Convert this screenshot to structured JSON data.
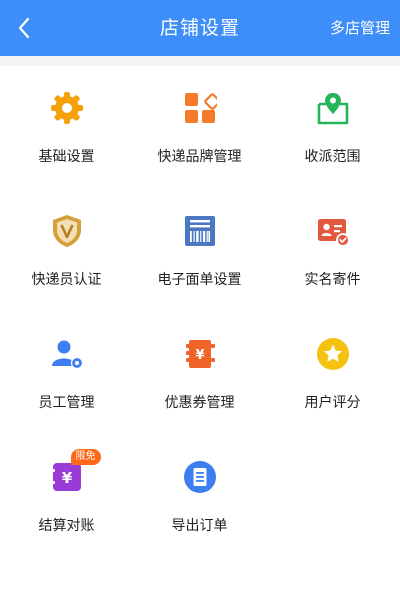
{
  "header": {
    "title": "店铺设置",
    "right_link": "多店管理",
    "back_icon": "chevron-left-icon",
    "bg_color": "#3d8ef8"
  },
  "menu": [
    {
      "id": "basic-settings",
      "label": "基础设置",
      "icon": "gear-icon",
      "color": "#f7a10a"
    },
    {
      "id": "courier-brand-management",
      "label": "快递品牌管理",
      "icon": "brand-blocks-icon",
      "color": "#f57a2a"
    },
    {
      "id": "delivery-range",
      "label": "收派范围",
      "icon": "map-pin-icon",
      "color": "#26b35a"
    },
    {
      "id": "courier-verification",
      "label": "快递员认证",
      "icon": "shield-v-icon",
      "color": "#d4a03a"
    },
    {
      "id": "e-waybill-settings",
      "label": "电子面单设置",
      "icon": "barcode-receipt-icon",
      "color": "#4a78c2"
    },
    {
      "id": "real-name-shipping",
      "label": "实名寄件",
      "icon": "id-card-icon",
      "color": "#e2583e"
    },
    {
      "id": "staff-management",
      "label": "员工管理",
      "icon": "staff-gear-icon",
      "color": "#3d7ef0"
    },
    {
      "id": "coupon-management",
      "label": "优惠券管理",
      "icon": "coupon-icon",
      "color": "#f0642a"
    },
    {
      "id": "user-ratings",
      "label": "用户评分",
      "icon": "star-icon",
      "color": "#f5c30f"
    },
    {
      "id": "settlement-reconciliation",
      "label": "结算对账",
      "icon": "yen-wallet-icon",
      "color": "#9a3bd8",
      "badge": "限免"
    },
    {
      "id": "export-orders",
      "label": "导出订单",
      "icon": "document-list-icon",
      "color": "#3d7ef0"
    }
  ]
}
